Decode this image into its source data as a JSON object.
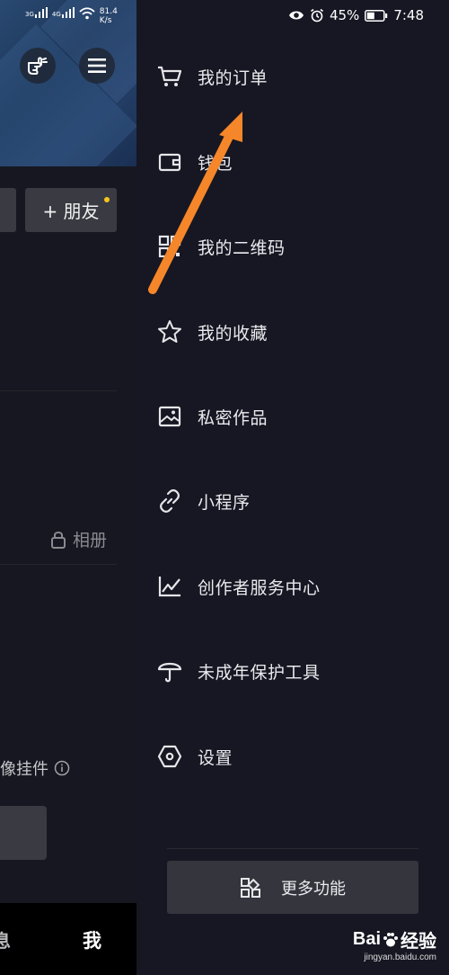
{
  "status_bar": {
    "signal1": "3G",
    "signal2": "4G",
    "speed_value": "81.4",
    "speed_unit": "K/s",
    "battery": "45%",
    "time": "7:48"
  },
  "profile": {
    "friend_button": "+ 朋友",
    "album_label": "相册",
    "widget_label": "像挂件",
    "tab_message": "息",
    "tab_me": "我"
  },
  "drawer": {
    "items": [
      {
        "label": "我的订单",
        "icon": "cart-icon"
      },
      {
        "label": "钱包",
        "icon": "wallet-icon"
      },
      {
        "label": "我的二维码",
        "icon": "qrcode-icon"
      },
      {
        "label": "我的收藏",
        "icon": "star-icon"
      },
      {
        "label": "私密作品",
        "icon": "image-icon"
      },
      {
        "label": "小程序",
        "icon": "link-icon"
      },
      {
        "label": "创作者服务中心",
        "icon": "chart-line-icon"
      },
      {
        "label": "未成年保护工具",
        "icon": "umbrella-icon"
      },
      {
        "label": "设置",
        "icon": "hexagon-settings-icon"
      }
    ],
    "more_button": "更多功能"
  },
  "watermark": {
    "logo_prefix": "Bai",
    "logo_suffix": "经验",
    "url": "jingyan.baidu.com"
  },
  "colors": {
    "drawer_bg": "#161722",
    "arrow": "#f5862a",
    "notification_dot": "#f5c61b"
  }
}
